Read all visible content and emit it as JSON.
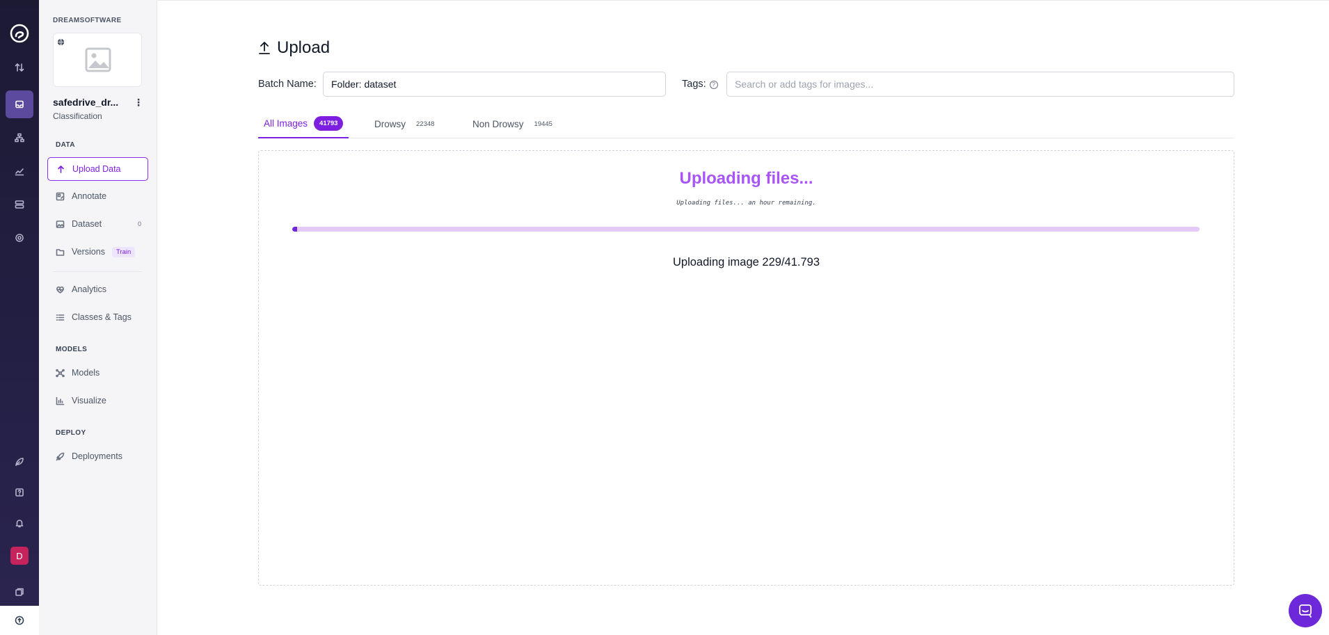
{
  "rail": {
    "icons": [
      "roboflow-logo-icon",
      "upload-swap-icon",
      "inbox-icon",
      "hierarchy-icon",
      "chart-line-icon",
      "server-icon",
      "gear-icon",
      "leaf-icon",
      "help-icon",
      "bell-icon",
      "docs-icon",
      "upload-circle-icon"
    ],
    "avatar_letter": "D",
    "active_color": "#5b4a9e",
    "avatar_color": "#c5235c"
  },
  "sidebar": {
    "workspace": "DREAMSOFTWARE",
    "project_name": "safedrive_dr...",
    "project_type": "Classification",
    "sections": {
      "data": "DATA",
      "models": "MODELS",
      "deploy": "DEPLOY"
    },
    "items": [
      {
        "label": "Upload Data",
        "icon": "arrow-up-icon",
        "active": true
      },
      {
        "label": "Annotate",
        "icon": "annotate-icon"
      },
      {
        "label": "Dataset",
        "icon": "image-icon",
        "count": "0"
      },
      {
        "label": "Versions",
        "icon": "folder-icon",
        "badge": "Train"
      },
      {
        "label": "Analytics",
        "icon": "heart-pulse-icon"
      },
      {
        "label": "Classes & Tags",
        "icon": "list-icon"
      },
      {
        "label": "Models",
        "icon": "network-icon"
      },
      {
        "label": "Visualize",
        "icon": "bar-chart-icon"
      },
      {
        "label": "Deployments",
        "icon": "rocket-icon"
      }
    ]
  },
  "main": {
    "title": "Upload",
    "batch_label": "Batch Name:",
    "batch_value": "Folder: dataset",
    "tags_label": "Tags:",
    "tags_placeholder": "Search or add tags for images...",
    "tabs": [
      {
        "label": "All Images",
        "count": "41793",
        "active": true
      },
      {
        "label": "Drowsy",
        "count": "22348"
      },
      {
        "label": "Non Drowsy",
        "count": "19445"
      }
    ],
    "upload": {
      "heading": "Uploading files...",
      "subtext": "Uploading files... an hour remaining.",
      "progress_fraction": 0.0055,
      "status": "Uploading image 229/41.793"
    },
    "accent_color": "#7c1fe0",
    "heading_color": "#a855f7"
  }
}
